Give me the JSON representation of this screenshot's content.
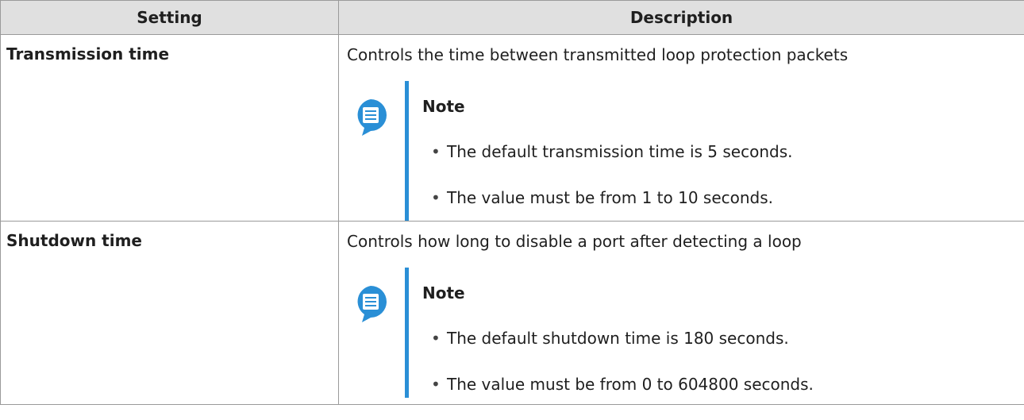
{
  "table": {
    "headers": {
      "setting": "Setting",
      "description": "Description"
    },
    "rows": [
      {
        "setting": "Transmission time",
        "description": "Controls the time between transmitted loop protection packets",
        "note_title": "Note",
        "note_items": [
          "The default transmission time is 5 seconds.",
          "The value must be from 1 to 10 seconds."
        ]
      },
      {
        "setting": "Shutdown time",
        "description": "Controls how long to disable a port after detecting a loop",
        "note_title": "Note",
        "note_items": [
          "The default shutdown time is 180 seconds.",
          "The value must be from 0 to 604800 seconds."
        ]
      }
    ]
  },
  "colors": {
    "header_bg": "#e0e0e0",
    "note_accent": "#2a8fd6",
    "border": "#9a9a9a"
  },
  "icons": {
    "note": "note-icon",
    "bullet": "•"
  }
}
